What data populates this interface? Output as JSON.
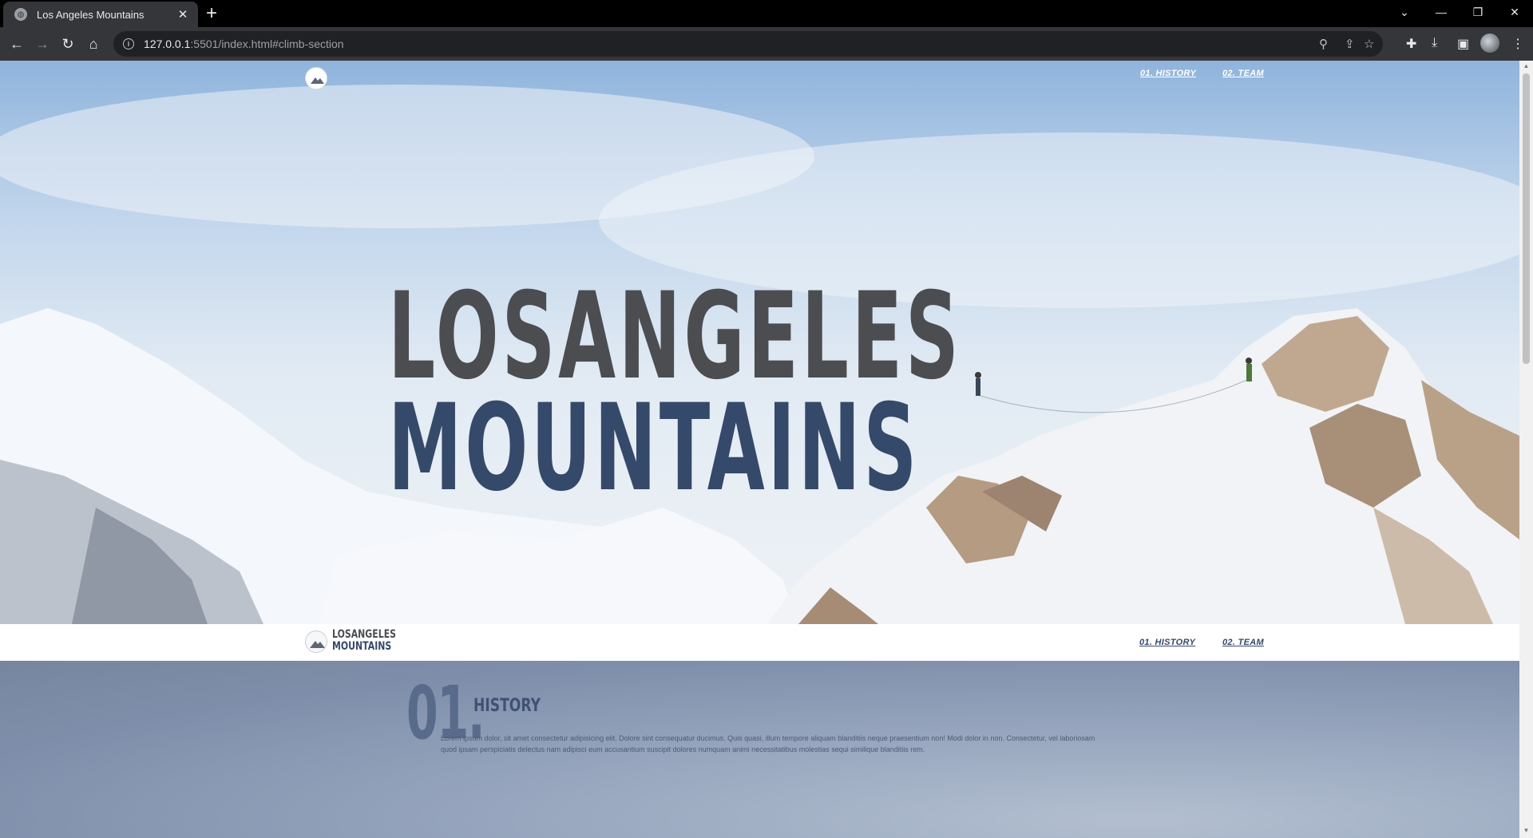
{
  "browser": {
    "tab_title": "Los Angeles Mountains",
    "url_host": "127.0.0.1",
    "url_rest": ":5501/index.html#climb-section",
    "icons": [
      "back-arrow-icon",
      "forward-arrow-icon",
      "reload-icon",
      "home-icon",
      "info-icon",
      "zoom-icon",
      "share-icon",
      "star-icon",
      "extensions-icon",
      "download-icon",
      "sidebar-icon",
      "profile-avatar",
      "menu-icon"
    ]
  },
  "hero": {
    "nav": [
      "01. HISTORY",
      "02. TEAM"
    ],
    "title_line1": "LOSANGELES",
    "title_line2": "MOUNTAINS"
  },
  "navbar": {
    "brand_line1": "LOSANGELES",
    "brand_line2": "MOUNTAINS",
    "links": [
      "01. HISTORY",
      "02. TEAM"
    ]
  },
  "history": {
    "number": "01.",
    "title": "HISTORY",
    "text": "Lorem ipsum dolor, sit amet consectetur adipisicing elit. Dolore sint consequatur ducimus. Quis quasi, illum tempore aliquam blanditiis neque praesentium non! Modi dolor in non. Consectetur, vel laboriosam quod ipsam perspiciatis delectus nam adipisci eum accusantium suscipit dolores numquam animi necessitatibus molestias sequi similique blanditiis rem."
  },
  "colors": {
    "title_gray": "#4b4d50",
    "title_blue": "#35496a",
    "chrome_dark": "#35363a"
  }
}
